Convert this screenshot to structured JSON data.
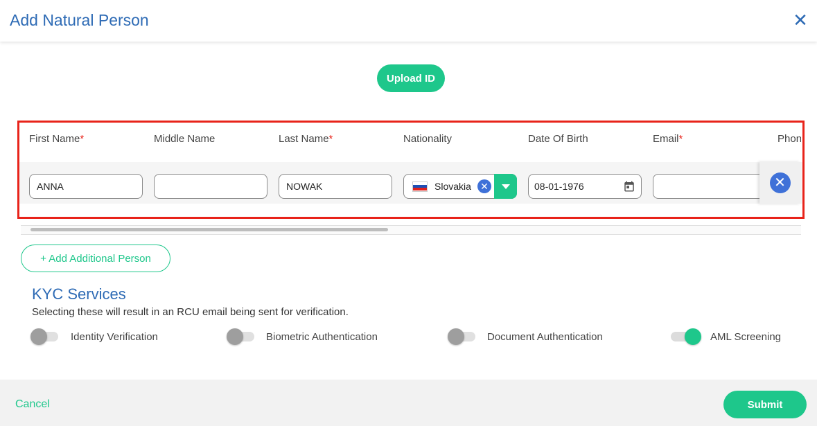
{
  "dialog": {
    "title": "Add Natural Person"
  },
  "actions": {
    "upload_label": "Upload ID",
    "add_person_label": "+ Add Additional Person",
    "cancel_label": "Cancel",
    "submit_label": "Submit"
  },
  "table": {
    "headers": [
      {
        "label": "First Name",
        "required": "*"
      },
      {
        "label": "Middle Name",
        "required": ""
      },
      {
        "label": "Last Name",
        "required": "*"
      },
      {
        "label": "Nationality",
        "required": ""
      },
      {
        "label": "Date Of Birth",
        "required": ""
      },
      {
        "label": "Email",
        "required": "*"
      },
      {
        "label": "Phon",
        "required": ""
      }
    ],
    "row": {
      "first_name": "ANNA",
      "middle_name": "",
      "last_name": "NOWAK",
      "nationality": "Slovakia",
      "date_of_birth": "08-01-1976",
      "email": ""
    }
  },
  "kyc": {
    "title": "KYC Services",
    "subtitle": "Selecting these will result in an RCU email being sent for verification.",
    "services": [
      {
        "label": "Identity Verification",
        "enabled": false
      },
      {
        "label": "Biometric Authentication",
        "enabled": false
      },
      {
        "label": "Document Authentication",
        "enabled": false
      },
      {
        "label": "AML Screening",
        "enabled": true
      }
    ]
  },
  "colors": {
    "accent": "#1ec78b",
    "title": "#2e6bb5",
    "required": "#e8231a",
    "highlight_box": "#e8231a"
  },
  "icons": {
    "close": "close-icon",
    "clear": "clear-icon",
    "dropdown": "chevron-down-icon",
    "calendar": "calendar-icon",
    "remove": "remove-icon",
    "flag": "slovakia-flag-icon"
  }
}
